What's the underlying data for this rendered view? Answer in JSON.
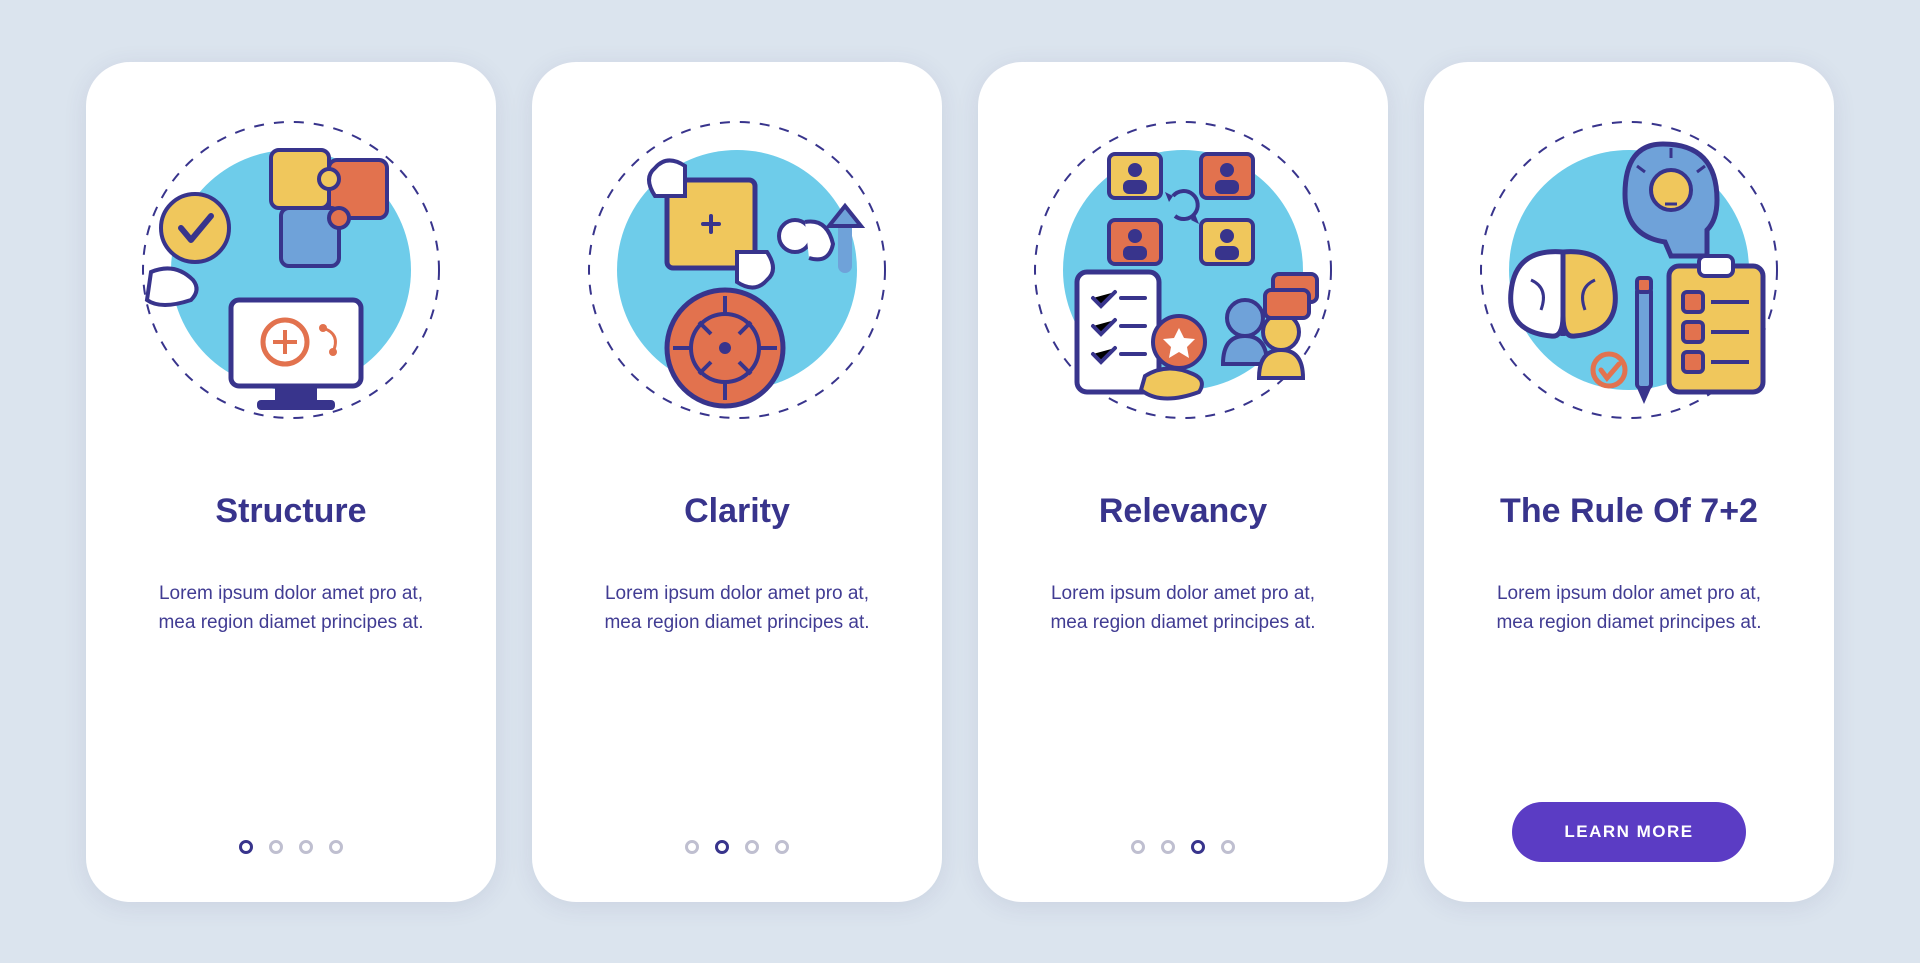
{
  "colors": {
    "accent": "#38348c",
    "accent2": "#5b3cc4",
    "orange": "#e2724e",
    "yellow": "#f0c75c",
    "blue": "#6fa2d9",
    "cyan": "#6eccea"
  },
  "lorem": "Lorem ipsum dolor amet pro at, mea region diamet principes at.",
  "cards": [
    {
      "title": "Structure",
      "body": "Lorem ipsum dolor amet pro at, mea region diamet principes at.",
      "activeDot": 0,
      "hasCta": false,
      "icon": "puzzle-computer-icon"
    },
    {
      "title": "Clarity",
      "body": "Lorem ipsum dolor amet pro at, mea region diamet principes at.",
      "activeDot": 1,
      "hasCta": false,
      "icon": "target-hands-icon"
    },
    {
      "title": "Relevancy",
      "body": "Lorem ipsum dolor amet pro at, mea region diamet principes at.",
      "activeDot": 2,
      "hasCta": false,
      "icon": "people-network-icon"
    },
    {
      "title": "The Rule Of 7+2",
      "body": "Lorem ipsum dolor amet pro at, mea region diamet principes at.",
      "activeDot": 3,
      "hasCta": true,
      "icon": "brain-checklist-icon"
    }
  ],
  "cta": {
    "label": "LEARN MORE"
  }
}
